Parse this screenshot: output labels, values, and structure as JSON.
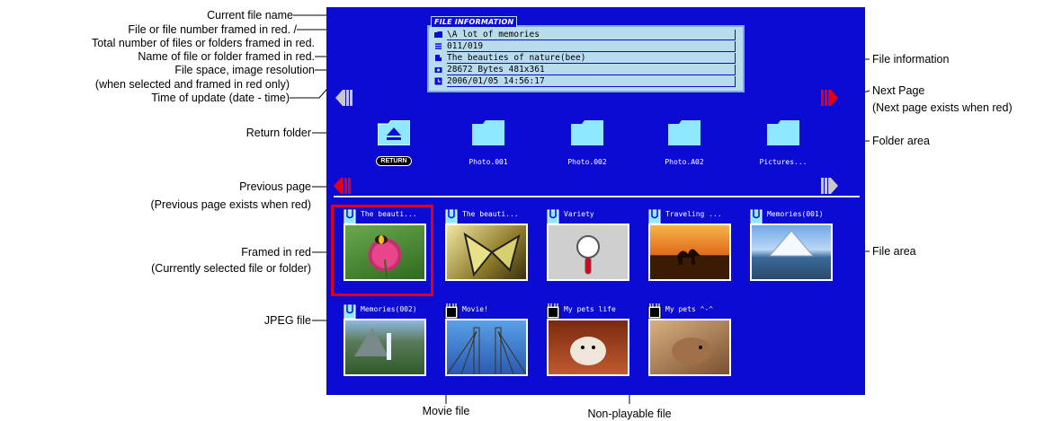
{
  "annotations": {
    "current_file_name": "Current file name",
    "file_number_framed": "File or file number framed in red. /",
    "total_files": "Total number of files or folders framed in red.",
    "name_framed": "Name of file or folder framed in red.",
    "file_space": "File space, image resolution",
    "when_selected": "(when selected and framed in red only)",
    "time_of_update": "Time of update (date - time)",
    "return_folder": "Return folder",
    "previous_page": "Previous page",
    "previous_page_note": "(Previous page exists when red)",
    "framed_in_red": "Framed in red",
    "framed_in_red_note": "(Currently selected file or folder)",
    "jpeg_file": "JPEG file",
    "movie_file": "Movie file",
    "non_playable_file": "Non-playable file",
    "file_information": "File information",
    "next_page": "Next Page",
    "next_page_note": "(Next page exists when red)",
    "folder_area": "Folder area",
    "file_area": "File area"
  },
  "file_information": {
    "tag": "FILE INFORMATION",
    "path": "\\A lot of memories",
    "count": "011/019",
    "name": "The beauties of nature(bee)",
    "size": "28672 Bytes    481x361",
    "date": "2006/01/05     14:56:17"
  },
  "folders": [
    {
      "label": "RETURN",
      "icon": "return-folder-icon"
    },
    {
      "label": "Photo.001",
      "icon": "folder-icon"
    },
    {
      "label": "Photo.002",
      "icon": "folder-icon"
    },
    {
      "label": "Photo.A02",
      "icon": "folder-icon"
    },
    {
      "label": "Pictures...",
      "icon": "folder-icon"
    }
  ],
  "files": [
    {
      "name": "The beauti...",
      "type": "jpeg",
      "thumb": "flower-bee"
    },
    {
      "name": "The beauti...",
      "type": "jpeg",
      "thumb": "butterfly"
    },
    {
      "name": "Variety",
      "type": "jpeg",
      "thumb": "non-playable"
    },
    {
      "name": "Traveling ...",
      "type": "jpeg",
      "thumb": "desert-sunset"
    },
    {
      "name": "Memories(001)",
      "type": "jpeg",
      "thumb": "mountain-lake"
    },
    {
      "name": "Memories(002)",
      "type": "jpeg",
      "thumb": "waterfall"
    },
    {
      "name": "Movie!",
      "type": "movie",
      "thumb": "bridge"
    },
    {
      "name": "My pets life",
      "type": "movie",
      "thumb": "hamster"
    },
    {
      "name": "My pets ^-^",
      "type": "movie",
      "thumb": "hamster-2"
    }
  ],
  "colors": {
    "screen_bg": "#0b0bd4",
    "active_arrow": "#e0001a",
    "inactive_arrow": "#c8c8c8",
    "folder": "#8ee8ff",
    "selection_frame": "#e0001a"
  }
}
